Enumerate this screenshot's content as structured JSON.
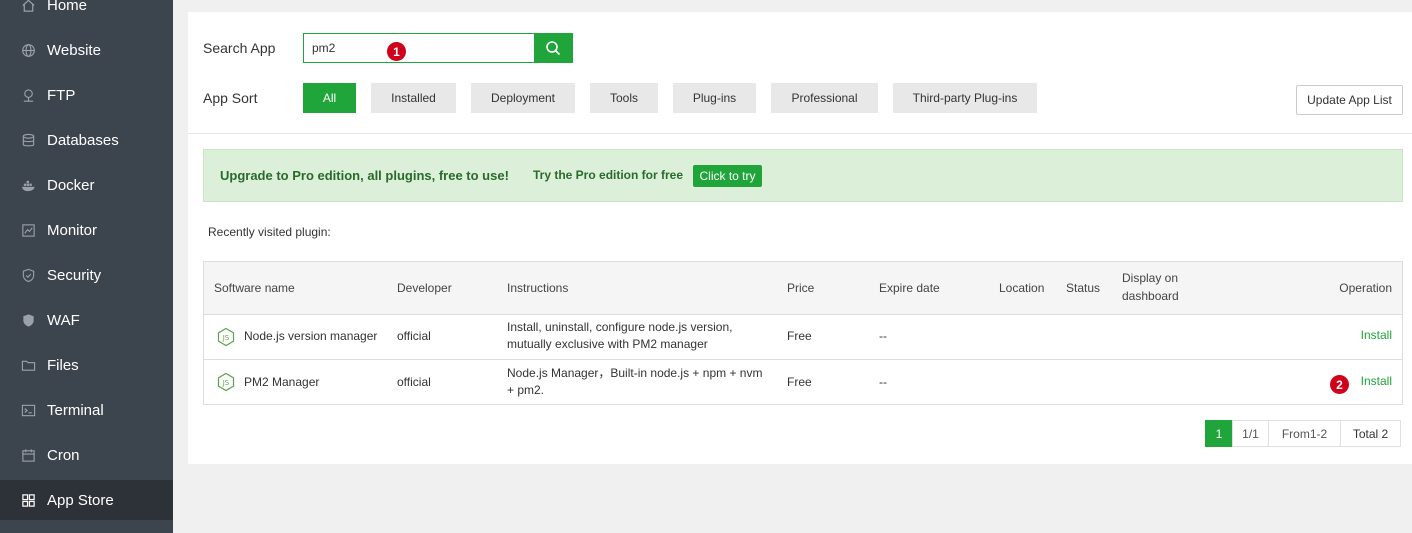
{
  "sidebar": {
    "items": [
      {
        "label": "Home",
        "icon": "home-icon"
      },
      {
        "label": "Website",
        "icon": "globe-icon"
      },
      {
        "label": "FTP",
        "icon": "ftp-icon"
      },
      {
        "label": "Databases",
        "icon": "database-icon"
      },
      {
        "label": "Docker",
        "icon": "docker-icon"
      },
      {
        "label": "Monitor",
        "icon": "monitor-icon"
      },
      {
        "label": "Security",
        "icon": "shield-icon"
      },
      {
        "label": "WAF",
        "icon": "waf-shield-icon"
      },
      {
        "label": "Files",
        "icon": "folder-icon"
      },
      {
        "label": "Terminal",
        "icon": "terminal-icon"
      },
      {
        "label": "Cron",
        "icon": "cron-icon"
      },
      {
        "label": "App Store",
        "icon": "grid-icon",
        "active": true
      }
    ]
  },
  "search": {
    "label": "Search App",
    "value": "pm2",
    "marker": "1"
  },
  "sort": {
    "label": "App Sort",
    "options": [
      "All",
      "Installed",
      "Deployment",
      "Tools",
      "Plug-ins",
      "Professional",
      "Third-party Plug-ins"
    ],
    "selected": "All"
  },
  "update_button": "Update App List",
  "promo": {
    "text": "Upgrade to Pro edition, all plugins, free to use!",
    "sub": "Try the Pro edition for free",
    "button": "Click to try"
  },
  "recent_label": "Recently visited plugin:",
  "table": {
    "headers": {
      "name": "Software name",
      "developer": "Developer",
      "instructions": "Instructions",
      "price": "Price",
      "expire": "Expire date",
      "location": "Location",
      "status": "Status",
      "display_1": "Display on",
      "display_2": "dashboard",
      "operation": "Operation"
    },
    "rows": [
      {
        "name": "Node.js version manager",
        "developer": "official",
        "instructions_1": "Install, uninstall, configure node.js version,",
        "instructions_2": "mutually exclusive with PM2 manager",
        "price": "Free",
        "expire": "--",
        "operation": "Install"
      },
      {
        "name": "PM2 Manager",
        "developer": "official",
        "instructions_1": "Node.js Manager，Built-in node.js + npm + nvm",
        "instructions_2": "+ pm2.",
        "price": "Free",
        "expire": "--",
        "operation": "Install",
        "marker": "2"
      }
    ]
  },
  "pagination": {
    "current": "1",
    "pages": "1/1",
    "range": "From1-2",
    "total": "Total 2"
  },
  "colors": {
    "accent": "#20a53a",
    "sidebar_bg": "#3c444d",
    "marker": "#d0021b",
    "promo_bg": "#dcf0d9"
  }
}
